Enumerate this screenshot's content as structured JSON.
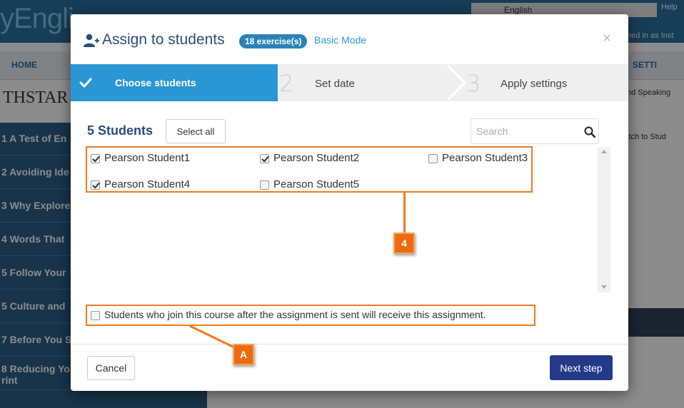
{
  "background": {
    "logo": "yEngli",
    "language": "English",
    "help": "Help",
    "signed_in": "ned in as Inst",
    "home": "HOME",
    "settings": "SETTI",
    "brand": "THSTAR",
    "speaking": "nd Speaking",
    "switch": "itch to Stud",
    "sidebar": [
      "1 A Test of En",
      "2 Avoiding Ide",
      "3 Why Explore",
      "4 Words That",
      "5 Follow Your",
      "5 Culture and",
      "7 Before You S",
      "8 Reducing Yo rint"
    ]
  },
  "modal": {
    "title": "Assign to students",
    "badge": "18 exercise(s)",
    "mode_link": "Basic Mode",
    "close": "×"
  },
  "stepper": {
    "steps": [
      {
        "num": "1",
        "label": "Choose students"
      },
      {
        "num": "2",
        "label": "Set date"
      },
      {
        "num": "3",
        "label": "Apply settings"
      }
    ]
  },
  "students": {
    "count_label": "5 Students",
    "select_all": "Select all",
    "search_placeholder": "Search",
    "list": [
      {
        "name": "Pearson Student1",
        "checked": true
      },
      {
        "name": "Pearson Student2",
        "checked": true
      },
      {
        "name": "Pearson Student3",
        "checked": false
      },
      {
        "name": "Pearson Student4",
        "checked": true
      },
      {
        "name": "Pearson Student5",
        "checked": false
      }
    ],
    "late_join_label": "Students who join this course after the assignment is sent will receive this assignment.",
    "late_join_checked": false
  },
  "footer": {
    "cancel": "Cancel",
    "next": "Next step"
  },
  "annotations": {
    "marker_4": "4",
    "marker_a": "A"
  },
  "colors": {
    "accent": "#2a97d4",
    "primary_button": "#24398a",
    "annotation": "#f07b1f"
  }
}
